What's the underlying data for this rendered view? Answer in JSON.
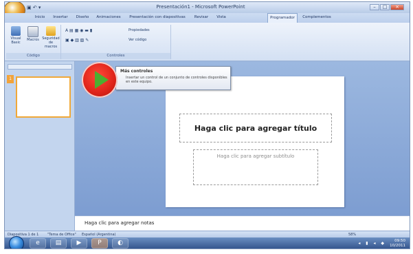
{
  "window": {
    "title": "Presentación1 - Microsoft PowerPoint",
    "controls": {
      "minimize": "–",
      "maximize": "□",
      "close": "×"
    },
    "quick_access": "▣ ↶ ▾"
  },
  "tabs": [
    {
      "label": "Inicio"
    },
    {
      "label": "Insertar"
    },
    {
      "label": "Diseño"
    },
    {
      "label": "Animaciones"
    },
    {
      "label": "Presentación con diapositivas"
    },
    {
      "label": "Revisar"
    },
    {
      "label": "Vista"
    },
    {
      "label": "Programador",
      "active": true
    },
    {
      "label": "Complementos"
    }
  ],
  "ribbon": {
    "group_code": {
      "label": "Código",
      "buttons": [
        {
          "label": "Visual Basic",
          "icon": "visual-basic-icon"
        },
        {
          "label": "Macros",
          "icon": "macros-icon"
        },
        {
          "label": "Seguridad de macros",
          "icon": "macro-security-icon"
        }
      ]
    },
    "group_controls": {
      "label": "Controles",
      "row1": "A ▤ ▦ ◉ ▬ ▮",
      "row2": "▣ ◆ ▥ ▧ ✎",
      "properties": "Propiedades",
      "view_code": "Ver código"
    }
  },
  "tooltip": {
    "title": "Más controles",
    "body": "Insertar un control de un conjunto de controles disponibles en este equipo."
  },
  "slide": {
    "title_placeholder": "Haga clic para agregar título",
    "subtitle_placeholder": "Haga clic para agregar subtítulo"
  },
  "notes": {
    "placeholder": "Haga clic para agregar notas"
  },
  "statusbar": {
    "slide_counter": "Diapositiva 1 de 1",
    "theme": "\"Tema de Office\"",
    "language": "Español (Argentina)",
    "zoom": "58%"
  },
  "taskbar": {
    "apps": [
      {
        "name": "internet-explorer",
        "glyph": "e"
      },
      {
        "name": "file-explorer",
        "glyph": "▤"
      },
      {
        "name": "media-player",
        "glyph": "▶"
      },
      {
        "name": "powerpoint",
        "glyph": "P"
      },
      {
        "name": "other-app",
        "glyph": "◐"
      }
    ],
    "tray": "◂ ▮ ◂ ◆",
    "time": "09:50",
    "date": "10/2011"
  }
}
